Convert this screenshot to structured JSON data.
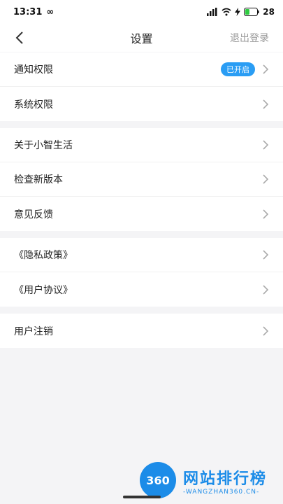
{
  "status": {
    "time": "13:31",
    "battery": "28"
  },
  "header": {
    "title": "设置",
    "logout": "退出登录"
  },
  "groups": [
    [
      {
        "label": "通知权限",
        "badge": "已开启"
      },
      {
        "label": "系统权限"
      }
    ],
    [
      {
        "label": "关于小智生活"
      },
      {
        "label": "检查新版本"
      },
      {
        "label": "意见反馈"
      }
    ],
    [
      {
        "label": "《隐私政策》"
      },
      {
        "label": "《用户协议》"
      }
    ],
    [
      {
        "label": "用户注销"
      }
    ]
  ],
  "watermark": {
    "badge": "360",
    "title": "网站排行榜",
    "subtitle": "-WANGZHAN360.CN-"
  }
}
